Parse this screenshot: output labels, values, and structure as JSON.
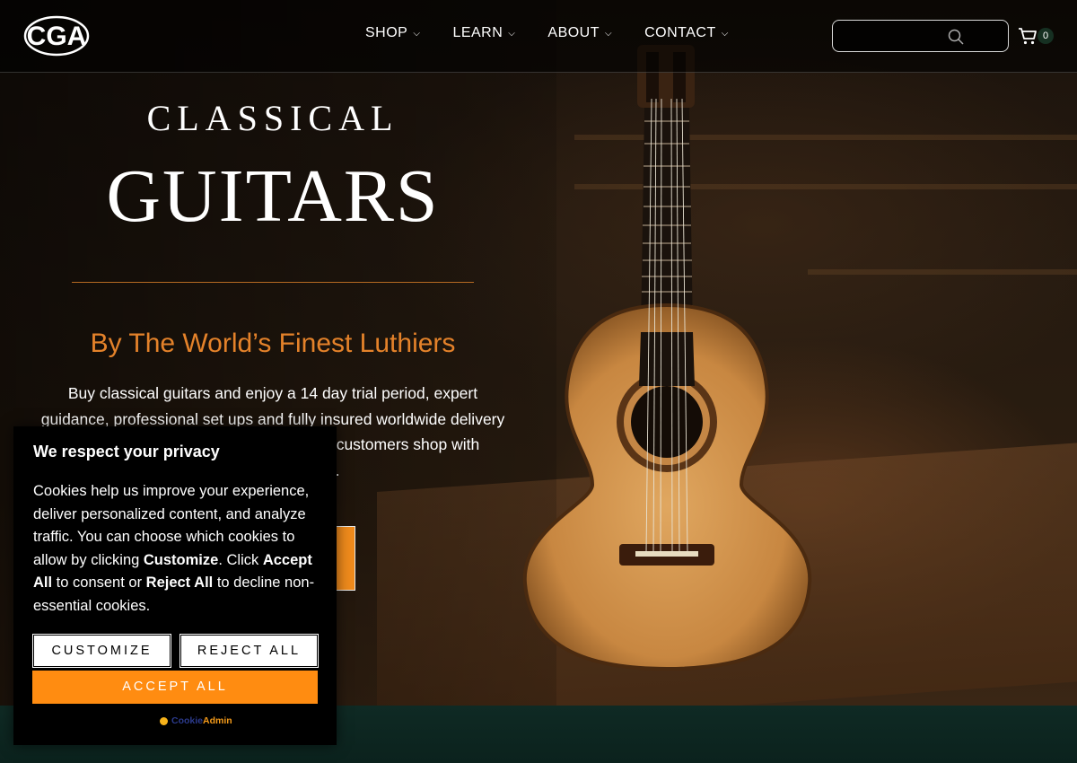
{
  "header": {
    "logo_text": "CGA",
    "nav": [
      {
        "label": "SHOP"
      },
      {
        "label": "LEARN"
      },
      {
        "label": "ABOUT"
      },
      {
        "label": "CONTACT"
      }
    ],
    "search": {
      "placeholder": "",
      "value": ""
    },
    "cart_count": "0"
  },
  "hero": {
    "kicker": "CLASSICAL",
    "headline": "GUITARS",
    "subhead": "By The World’s Finest Luthiers",
    "intro_line1": "Buy classical guitars and enjoy a 14 day trial period, expert",
    "intro_line2": "guidance, professional set ups and fully insured worldwide delivery",
    "intro_line3_visible": "r customers shop with",
    "intro_line4_visible": "e."
  },
  "cookie_banner": {
    "title": "We respect your privacy",
    "body_part1": "Cookies help us improve your experience, deliver personalized content, and analyze traffic. You can choose which cookies to allow by clicking ",
    "customize_word": "Customize",
    "body_part2": ". Click ",
    "accept_word": "Accept All",
    "body_part3": " to consent or ",
    "reject_word": "Reject All",
    "body_part4": " to decline non-essential cookies.",
    "customize_label": "CUSTOMIZE",
    "reject_label": "REJECT ALL",
    "accept_label": "ACCEPT ALL",
    "powered_a": "Cookie",
    "powered_b": "Admin"
  },
  "colors": {
    "accent_orange": "#ff8c11",
    "subhead_orange": "#e4822a",
    "divider": "#b66a22",
    "footer_green": "#0f2a24"
  }
}
